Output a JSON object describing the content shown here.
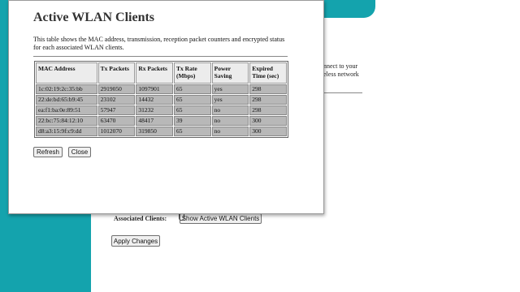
{
  "background": {
    "text_line1": "nnect to your",
    "text_line2": "eless network",
    "associated_clients_label": "Associated Clients:",
    "show_clients_button": "Show Active WLAN Clients",
    "apply_button": "Apply Changes"
  },
  "popup": {
    "title": "Active WLAN Clients",
    "description": "This table shows the MAC address, transmission, reception packet counters and encrypted status for each associated WLAN clients.",
    "columns": [
      "MAC Address",
      "Tx Packets",
      "Rx Packets",
      "Tx Rate (Mbps)",
      "Power Saving",
      "Expired Time (sec)"
    ],
    "rows": [
      [
        "1c:02:19:2c:35:bb",
        "2919050",
        "1097901",
        "65",
        "yes",
        "298"
      ],
      [
        "22:de:bd:65:b9:45",
        "23102",
        "14432",
        "65",
        "yes",
        "298"
      ],
      [
        "ea:f1:ba:0e:89:51",
        "57947",
        "31232",
        "65",
        "no",
        "298"
      ],
      [
        "22:bc:75:84:12:10",
        "63470",
        "48417",
        "39",
        "no",
        "300"
      ],
      [
        "d8:a3:15:9f:c9:dd",
        "1012070",
        "319850",
        "65",
        "no",
        "300"
      ]
    ],
    "refresh_button": "Refresh",
    "close_button": "Close"
  },
  "colors": {
    "teal": "#14a3ad",
    "row_bg": "#b8b8b8",
    "header_bg": "#ececec"
  }
}
